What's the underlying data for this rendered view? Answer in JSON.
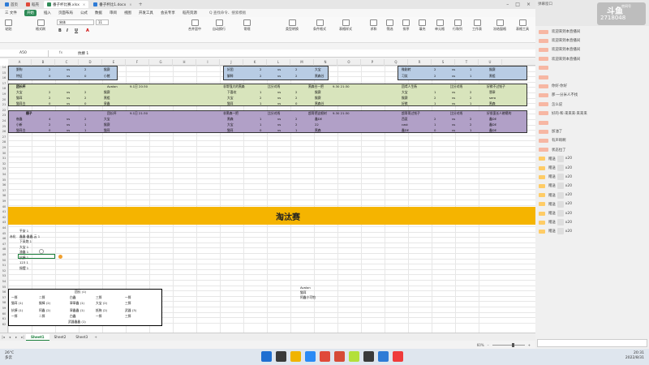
{
  "tabs": [
    {
      "label": "首页",
      "color": "#2e7bd6",
      "active": false
    },
    {
      "label": "稻壳",
      "color": "#e04a3a",
      "active": false
    },
    {
      "label": "番子杯比赛.xlsx",
      "color": "#2e8b57",
      "active": true
    },
    {
      "label": "番子杯比1.docx",
      "color": "#2e7bd6",
      "active": false
    }
  ],
  "menu": [
    "三 文件",
    "开始",
    "插入",
    "页面布局",
    "公式",
    "数据",
    "审阅",
    "视图",
    "开发工具",
    "会员专享",
    "稻壳资源",
    "Q 查找命令、搜索模板"
  ],
  "ribbon": {
    "buttons": [
      "粘贴",
      "格式刷",
      "合并居中",
      "自动换行",
      "常规",
      "类型转换",
      "条件格式",
      "表格样式",
      "求和",
      "筛选",
      "排序",
      "填充",
      "单元格",
      "行和列",
      "工作表",
      "冻结窗格",
      "表格工具"
    ],
    "font": "宋体",
    "size": "11"
  },
  "formula": {
    "cell": "A50",
    "fx": "fx",
    "content": "抗揍 1"
  },
  "columns": [
    "A",
    "B",
    "C",
    "D",
    "E",
    "F",
    "G",
    "H",
    "I",
    "J",
    "K",
    "L",
    "M",
    "N",
    "O",
    "P",
    "Q",
    "R",
    "S",
    "T",
    "U"
  ],
  "rows": [
    "14",
    "15",
    "16",
    "17",
    "18",
    "19",
    "20",
    "21",
    "22",
    "23",
    "24",
    "25",
    "26",
    "27",
    "28",
    "29",
    "30",
    "31",
    "32",
    "33",
    "34",
    "35",
    "36",
    "37",
    "38",
    "39",
    "40",
    "41",
    "42",
    "43",
    "44",
    "45",
    "46",
    "47",
    "48",
    "49",
    "50",
    "51",
    "52",
    "53",
    "54",
    "55",
    "56",
    "57",
    "58",
    "59",
    "60",
    "61",
    "62"
  ],
  "blocks": {
    "blue": [
      [
        "野狗",
        "2",
        "vs",
        "2",
        "猴赛"
      ],
      [
        "特征",
        "0",
        "vs",
        "0",
        "小猪"
      ],
      [
        "好团",
        "2",
        "vs",
        "2",
        "大宝"
      ],
      [
        "解释",
        "2",
        "vs",
        "2",
        "黑森谷"
      ],
      [
        "微刚转",
        "2",
        "vs",
        "1",
        "猴赛"
      ],
      [
        "习笑",
        "2",
        "vs",
        "1",
        "黑祖"
      ]
    ],
    "green_titles": [
      "团长杯",
      "Avalon",
      "9.1日 20:30",
      "非常强大的黑森",
      "比分对线",
      "黑森台一把",
      "9.30 21:30",
      "团鸢人生杨",
      "比分对线",
      "好棋不过钱子"
    ],
    "green": [
      [
        "大宝",
        "2",
        "vs",
        "2",
        "猴赛"
      ],
      [
        "猫耳",
        "2",
        "vs",
        "2",
        "黑祖"
      ],
      [
        "猫耳白",
        "0",
        "vs",
        "0",
        "泉鑫"
      ],
      [
        "下喜欢",
        "1",
        "vs",
        "2",
        "猴赛"
      ],
      [
        "大宝",
        "2",
        "vs",
        "2",
        "猴赛"
      ],
      [
        "猫耳",
        "1",
        "vs",
        "0",
        "黑森谷"
      ],
      [
        "大宝",
        "1",
        "vs",
        "2",
        "翡翠"
      ],
      [
        "猴赛",
        "2",
        "vs",
        "2",
        "sero"
      ],
      [
        "好棋",
        "1",
        "vs",
        "1",
        "黑森"
      ]
    ],
    "purple_titles": [
      "栅子",
      "团长杯",
      "9.1日 21:30",
      "非黑森一把",
      "比分对线",
      "超哥把这根树",
      "9.30 21:30",
      "超哥哥过钱子",
      "比分对线",
      "好很蛮长人粮嗯的"
    ],
    "purple": [
      [
        "崔鑫",
        "4",
        "vs",
        "2",
        "大宝"
      ],
      [
        "小新",
        "2",
        "vs",
        "1",
        "猴赛"
      ],
      [
        "猫耳白",
        "0",
        "vs",
        "1",
        "猫耳"
      ],
      [
        "黑森",
        "1",
        "vs",
        "2",
        "鑫DE"
      ],
      [
        "大宝",
        "1",
        "vs",
        "2",
        "22"
      ],
      [
        "猫耳",
        "0",
        "vs",
        "1",
        "黑森"
      ],
      [
        "西夏",
        "2",
        "vs",
        "2",
        "鑫DE"
      ],
      [
        "cast",
        "1",
        "vs",
        "2",
        "鑫DE"
      ],
      [
        "鑫DE",
        "0",
        "vs",
        "1",
        "鑫DE"
      ]
    ]
  },
  "side_list": [
    "平安 1",
    "鑫鑫·鑫鑫-云 1",
    "下采炮 1",
    "大宝 1",
    "渣鑫 1",
    "抗揍 1",
    "123 1",
    "摇摆 1"
  ],
  "side_prefix": "赤化",
  "banner": "淘汰赛",
  "right_notes": [
    "Avalon",
    "猫耳",
    "阿鑫小可怕"
  ],
  "bracket": {
    "row1": [
      "团长 (1)"
    ],
    "row2": [
      "一胖",
      "二胖",
      "白鑫",
      "三胖",
      "一胖"
    ],
    "row3": [
      "猫耳 (1)",
      "猴棒 (2)",
      "翠翠鑫 (1)",
      "大宝 (2)",
      "三胖"
    ],
    "row4": [
      "抗揍 (1)",
      "阿鑫 (2)",
      "翠鑫鑫 (1)",
      "抵拖 (2)",
      "武器 (3)"
    ],
    "row5": [
      "一胖",
      "二胖",
      "白鑫",
      "一胖",
      "三胖"
    ],
    "row6": [
      "武器鑫鑫 (1)"
    ]
  },
  "sheets": [
    "Sheet1",
    "Sheet2",
    "Sheet3"
  ],
  "active_sheet": "Sheet1",
  "zoom": "60%",
  "chat": {
    "title": "弹幕窗口",
    "streamer": "斗鱼",
    "room_id": "2718048",
    "room_label": "房间号",
    "messages": [
      {
        "user": "",
        "text": "欢迎来到本直播间",
        "type": "sys"
      },
      {
        "user": "",
        "text": "欢迎来到本直播间",
        "type": "sys"
      },
      {
        "user": "",
        "text": "欢迎来到本直播间",
        "type": "sys"
      },
      {
        "user": "",
        "text": "欢迎来到本直播间",
        "type": "sys"
      },
      {
        "user": "",
        "text": "",
        "type": "sys"
      },
      {
        "user": "",
        "text": "",
        "type": "sys"
      },
      {
        "user": "",
        "text": "你好·你好",
        "type": "user"
      },
      {
        "user": "",
        "text": "那·一分米人不找",
        "type": "user"
      },
      {
        "user": "",
        "text": "怎么说",
        "type": "user"
      },
      {
        "user": "",
        "text": "好的·和·来来来·来来来",
        "type": "user"
      },
      {
        "user": "",
        "text": "",
        "type": "user"
      },
      {
        "user": "",
        "text": "加油了",
        "type": "user"
      },
      {
        "user": "",
        "text": "有声响啊",
        "type": "user"
      },
      {
        "user": "",
        "text": "状态拉了",
        "type": "user"
      },
      {
        "user": "",
        "text": "赠送 ",
        "gift": "x20",
        "type": "gift"
      },
      {
        "user": "",
        "text": "赠送 ",
        "gift": "x20",
        "type": "gift"
      },
      {
        "user": "",
        "text": "赠送 ",
        "gift": "x20",
        "type": "gift"
      },
      {
        "user": "",
        "text": "赠送 ",
        "gift": "x20",
        "type": "gift"
      },
      {
        "user": "",
        "text": "赠送 ",
        "gift": "x20",
        "type": "gift"
      },
      {
        "user": "",
        "text": "赠送 ",
        "gift": "x20",
        "type": "gift"
      },
      {
        "user": "",
        "text": "赠送 ",
        "gift": "x20",
        "type": "gift"
      },
      {
        "user": "",
        "text": "赠送 ",
        "gift": "x20",
        "type": "gift"
      },
      {
        "user": "",
        "text": "赠送 ",
        "gift": "x20",
        "type": "gift"
      }
    ]
  },
  "taskbar": {
    "weather_temp": "26°C",
    "weather_desc": "多云",
    "time": "20:31",
    "date": "2022/8/31",
    "icon_colors": [
      "#1f6fd1",
      "#3a3a3a",
      "#f0b400",
      "#2a8af5",
      "#e04a3a",
      "#d64a37",
      "#b3e03a",
      "#3a3a3a",
      "#2e7bd6",
      "#ef3b3b"
    ]
  }
}
